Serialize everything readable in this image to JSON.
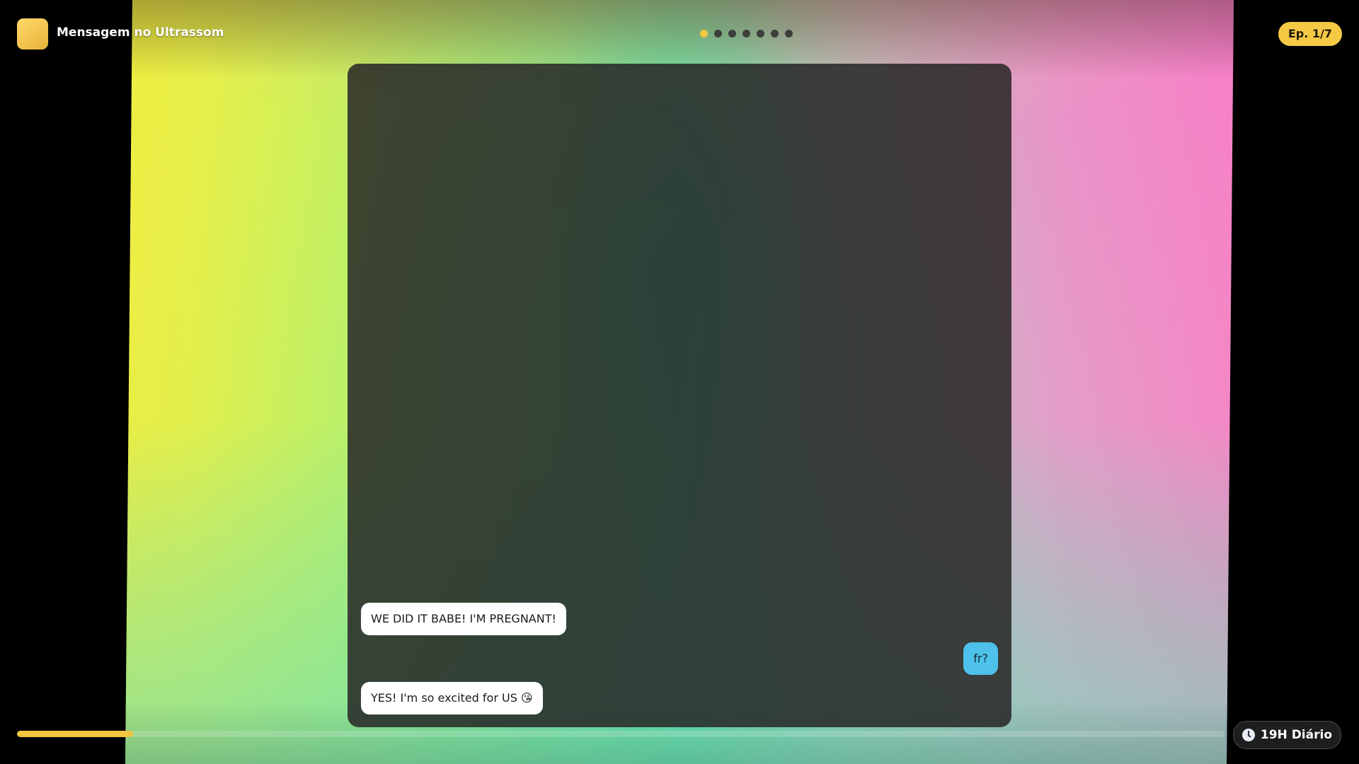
{
  "header": {
    "title": "Mensagem no Ultrassom",
    "episode_badge": "Ep. 1/7",
    "pagination": {
      "total": 7,
      "current": 1
    }
  },
  "chat": {
    "messages": [
      {
        "side": "received",
        "text": "WE DID IT BABE! I'M PREGNANT!"
      },
      {
        "side": "sent",
        "text": "fr?"
      },
      {
        "side": "received",
        "text": "YES! I'm so excited for US 😘"
      }
    ]
  },
  "footer": {
    "progress": 0.096,
    "schedule_label": "19H Diário",
    "schedule_icon": "clock-icon"
  },
  "colors": {
    "accent": "#f2c640",
    "sent_bubble": "#4ec1ea",
    "received_bubble": "#ffffff",
    "panel": "#262626"
  }
}
